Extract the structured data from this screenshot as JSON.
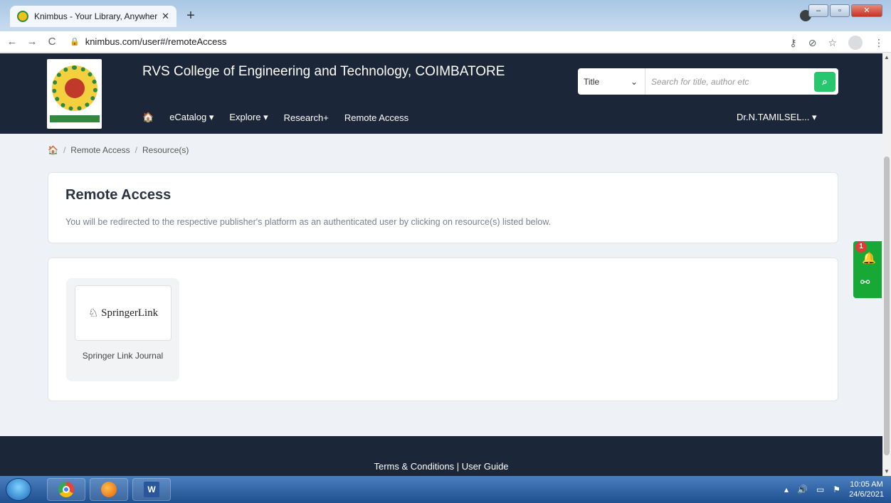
{
  "browser": {
    "tab_title": "Knimbus - Your Library, Anywher",
    "tab_close": "✕",
    "new_tab": "+",
    "url": "knimbus.com/user#/remoteAccess",
    "back": "←",
    "forward": "→",
    "reload": "C"
  },
  "header": {
    "college_name": "RVS College of Engineering and Technology, COIMBATORE",
    "nav": {
      "home": "🏠",
      "ecatalog": "eCatalog ▾",
      "explore": "Explore ▾",
      "research": "Research+",
      "remote_access": "Remote Access"
    },
    "search": {
      "type": "Title",
      "placeholder": "Search for title, author etc"
    },
    "user": "Dr.N.TAMILSEL... ▾"
  },
  "breadcrumb": {
    "home": "🏠",
    "sep": "/",
    "items": [
      "Remote Access",
      "Resource(s)"
    ]
  },
  "intro": {
    "title": "Remote Access",
    "description": "You will be redirected to the respective publisher's platform as an authenticated user by clicking on resource(s) listed below."
  },
  "resources": [
    {
      "logo_text": "SpringerLink",
      "name": "Springer Link Journal"
    }
  ],
  "float": {
    "notification_count": "1"
  },
  "footer": {
    "links": "Terms & Conditions | User Guide"
  },
  "taskbar": {
    "time": "10:05 AM",
    "date": "24/6/2021",
    "word_label": "W"
  }
}
